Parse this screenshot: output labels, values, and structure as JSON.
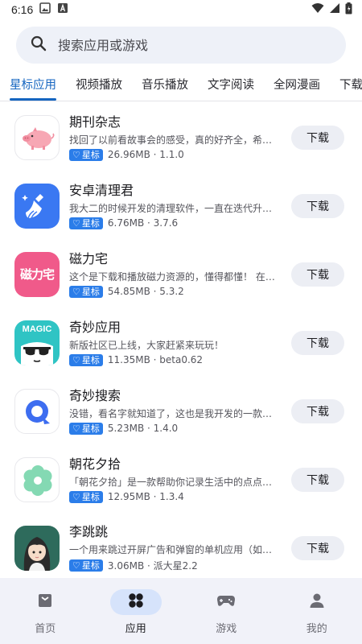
{
  "status_bar": {
    "time": "6:16"
  },
  "search": {
    "placeholder": "搜索应用或游戏"
  },
  "tabs": [
    {
      "label": "星标应用",
      "active": true
    },
    {
      "label": "视频播放"
    },
    {
      "label": "音乐播放"
    },
    {
      "label": "文字阅读"
    },
    {
      "label": "全网漫画"
    },
    {
      "label": "下载工"
    }
  ],
  "apps": [
    {
      "name": "期刊杂志",
      "desc": "找回了以前看故事会的感受，真的好齐全，希望...",
      "badge": "星标",
      "meta": "26.96MB · 1.1.0",
      "button": "下载",
      "icon": "pig-icon"
    },
    {
      "name": "安卓清理君",
      "desc": "我大二的时候开发的清理软件，一直在迭代升级...",
      "badge": "星标",
      "meta": "6.76MB · 3.7.6",
      "button": "下载",
      "icon": "broom-icon"
    },
    {
      "name": "磁力宅",
      "desc": "这个是下载和播放磁力资源的，懂得都懂！  在国...",
      "badge": "星标",
      "meta": "54.85MB · 5.3.2",
      "button": "下载",
      "icon": "magnet-logo-icon",
      "icon_text": "磁力宅"
    },
    {
      "name": "奇妙应用",
      "desc": "新版社区已上线，大家赶紧来玩玩！",
      "badge": "星标",
      "meta": "11.35MB · beta0.62",
      "button": "下载",
      "icon": "magic-sunglasses-icon",
      "icon_text": "MAGIC"
    },
    {
      "name": "奇妙搜索",
      "desc": "没错，看名字就知道了，这也是我开发的一款神...",
      "badge": "星标",
      "meta": "5.23MB · 1.4.0",
      "button": "下载",
      "icon": "search-q-icon"
    },
    {
      "name": "朝花夕拾",
      "desc": "「朝花夕拾」是一款帮助你记录生活中的点点滴...",
      "badge": "星标",
      "meta": "12.95MB · 1.3.4",
      "button": "下载",
      "icon": "flower-icon"
    },
    {
      "name": "李跳跳",
      "desc": "一个用来跳过开屏广告和弹窗的单机应用（如果...",
      "badge": "星标",
      "meta": "3.06MB · 派大星2.2",
      "button": "下载",
      "icon": "girl-avatar-icon"
    }
  ],
  "bottom_nav": [
    {
      "label": "首页",
      "icon": "home-icon"
    },
    {
      "label": "应用",
      "icon": "apps-icon",
      "active": true
    },
    {
      "label": "游戏",
      "icon": "gamepad-icon"
    },
    {
      "label": "我的",
      "icon": "person-icon"
    }
  ],
  "colors": {
    "accent": "#1565c0",
    "badge": "#2b7de9",
    "search_bg": "#eef1f8",
    "nav_bg": "#f1f2f9"
  }
}
